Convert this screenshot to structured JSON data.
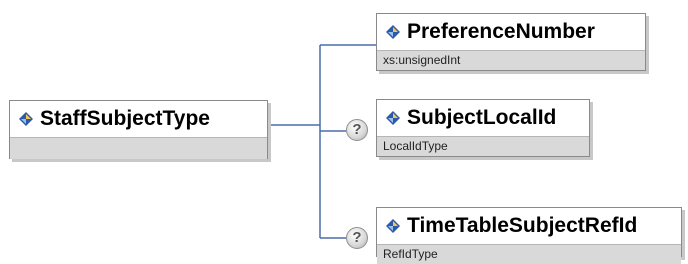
{
  "root": {
    "name": "StaffSubjectType"
  },
  "children": [
    {
      "name": "PreferenceNumber",
      "type": "xs:unsignedInt",
      "optional": false
    },
    {
      "name": "SubjectLocalId",
      "type": "LocalIdType",
      "optional": true
    },
    {
      "name": "TimeTableSubjectRefId",
      "type": "RefIdType",
      "optional": true
    }
  ],
  "optional_marker": "?",
  "colors": {
    "connector": "#4a6fa5",
    "footer": "#d9d9d9",
    "diamond_light": "#f6c74a",
    "diamond_dark": "#2d5aa8"
  }
}
